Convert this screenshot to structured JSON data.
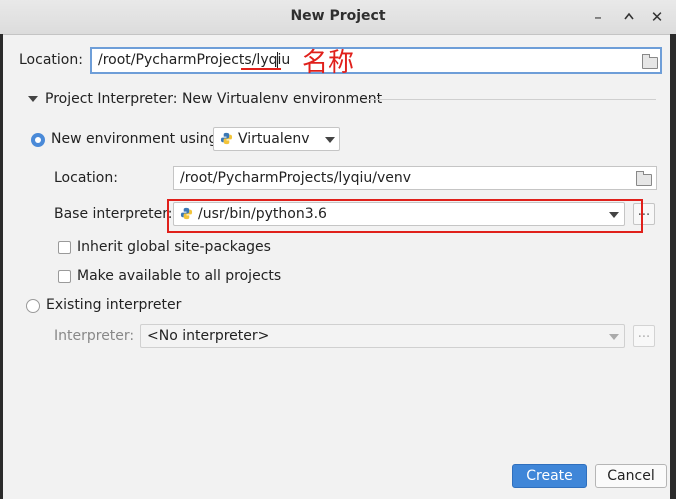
{
  "window": {
    "title": "New Project"
  },
  "location": {
    "label": "Location:",
    "value": "/root/PycharmProjects/lyqiu"
  },
  "interpreter_section": {
    "title": "Project Interpreter: New Virtualenv environment"
  },
  "new_env": {
    "label": "New environment using",
    "tool_value": "Virtualenv",
    "location_label": "Location:",
    "location_value": "/root/PycharmProjects/lyqiu/venv",
    "base_label": "Base interpreter:",
    "base_value": "/usr/bin/python3.6",
    "inherit_label": "Inherit global site-packages",
    "available_label": "Make available to all projects"
  },
  "existing": {
    "label": "Existing interpreter",
    "interp_label": "Interpreter:",
    "interp_value": "<No interpreter>"
  },
  "buttons": {
    "create": "Create",
    "cancel": "Cancel",
    "ellipsis": "..."
  },
  "annotation": {
    "text": "名称",
    "color": "#e0201b"
  },
  "colors": {
    "accent": "#3f86d8",
    "annotation": "#e0201b"
  }
}
